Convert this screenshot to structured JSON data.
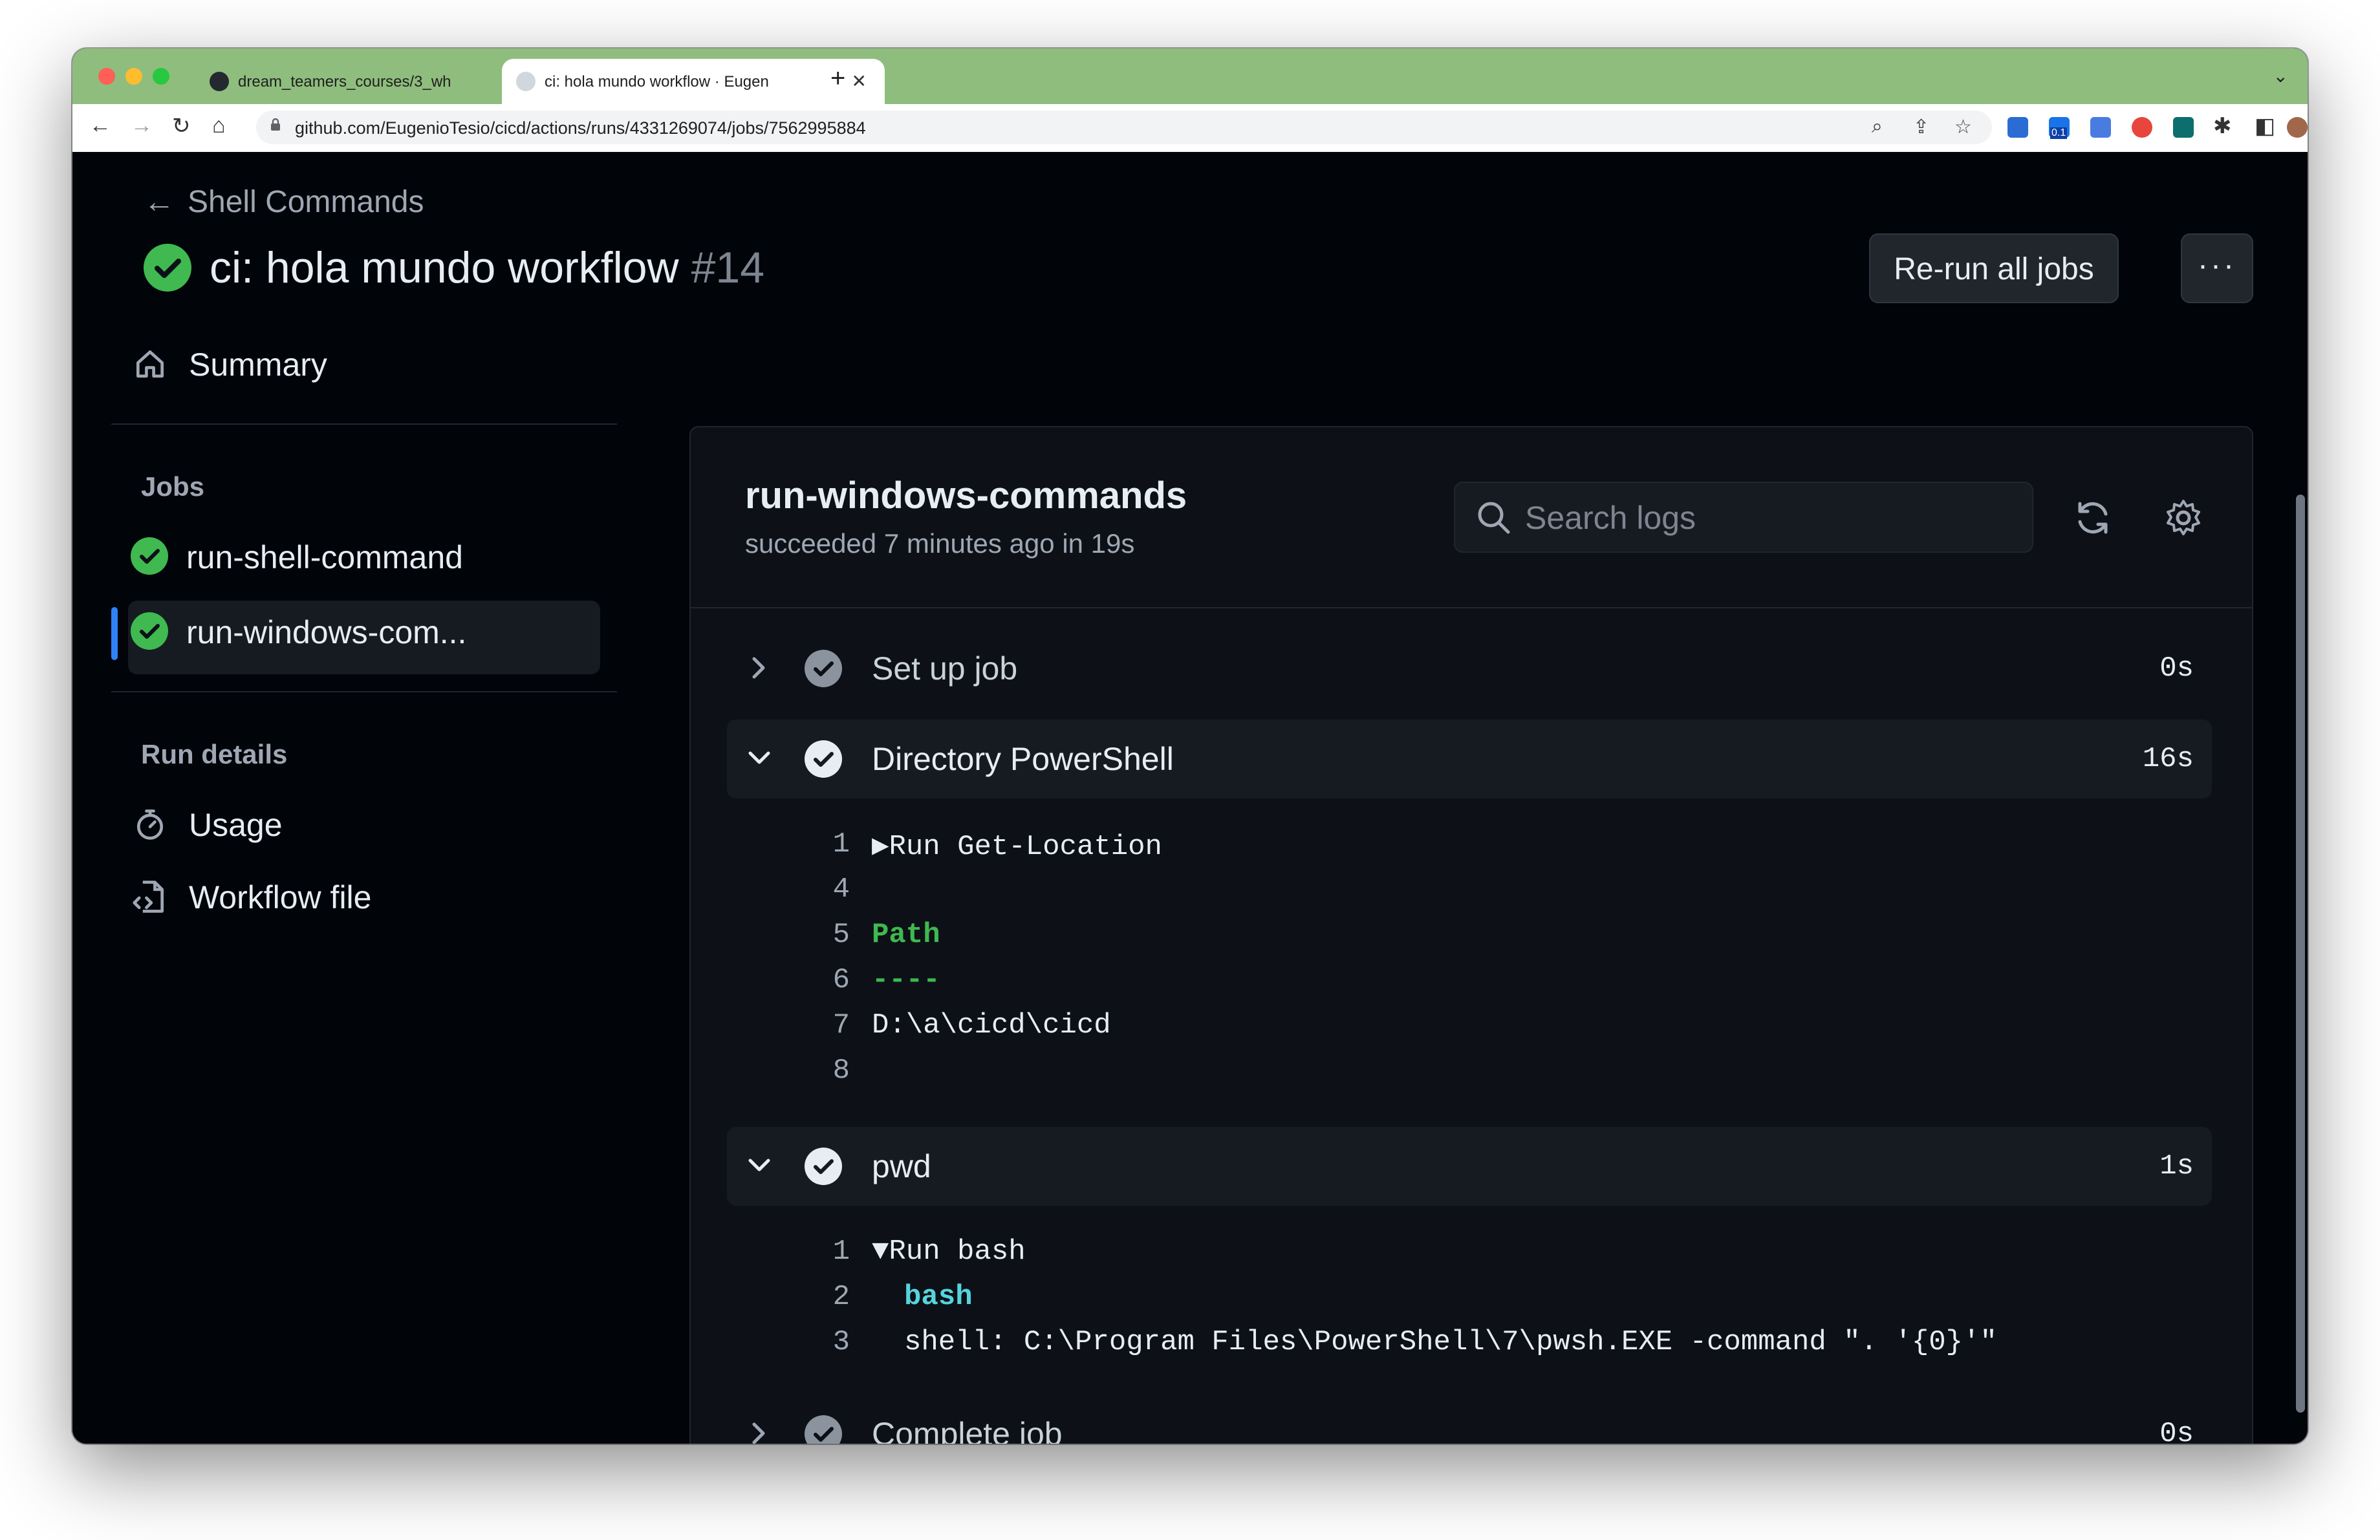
{
  "browser": {
    "tabs": [
      {
        "title": "dream_teamers_courses/3_wh"
      },
      {
        "title": "ci: hola mundo workflow · Eugen"
      }
    ],
    "new_tab": "+",
    "url": "github.com/EugenioTesio/cicd/actions/runs/4331269074/jobs/7562995884",
    "extension_badge": "0.1"
  },
  "header": {
    "back_label": "Shell Commands",
    "run_title": "ci: hola mundo workflow",
    "run_number": "#14",
    "rerun_label": "Re-run all jobs",
    "more_label": "···"
  },
  "sidebar": {
    "summary": "Summary",
    "jobs_heading": "Jobs",
    "jobs": [
      {
        "label": "run-shell-command"
      },
      {
        "label": "run-windows-com..."
      }
    ],
    "run_details_heading": "Run details",
    "usage": "Usage",
    "workflow_file": "Workflow file"
  },
  "job": {
    "name": "run-windows-commands",
    "status": "succeeded 7 minutes ago in 19s",
    "search_placeholder": "Search logs"
  },
  "steps": [
    {
      "name": "Set up job",
      "duration": "0s",
      "expanded": false
    },
    {
      "name": "Directory PowerShell",
      "duration": "16s",
      "expanded": true,
      "lines": [
        {
          "n": "1",
          "text": "▶Run Get-Location"
        },
        {
          "n": "4",
          "text": ""
        },
        {
          "n": "5",
          "text": "Path"
        },
        {
          "n": "6",
          "text": "----"
        },
        {
          "n": "7",
          "text": "D:\\a\\cicd\\cicd"
        },
        {
          "n": "8",
          "text": ""
        }
      ]
    },
    {
      "name": "pwd",
      "duration": "1s",
      "expanded": true,
      "lines": [
        {
          "n": "1",
          "text": "▼Run bash"
        },
        {
          "n": "2",
          "text": "bash"
        },
        {
          "n": "3",
          "text": "shell: C:\\Program Files\\PowerShell\\7\\pwsh.EXE -command \". '{0}'\""
        }
      ]
    },
    {
      "name": "Complete job",
      "duration": "0s",
      "expanded": false
    }
  ],
  "colors": {
    "success": "#3fb950",
    "accent": "#2f81f7",
    "background": "#010409",
    "panel": "#0d1117",
    "chrome_tab_strip": "#8fbd7d"
  }
}
